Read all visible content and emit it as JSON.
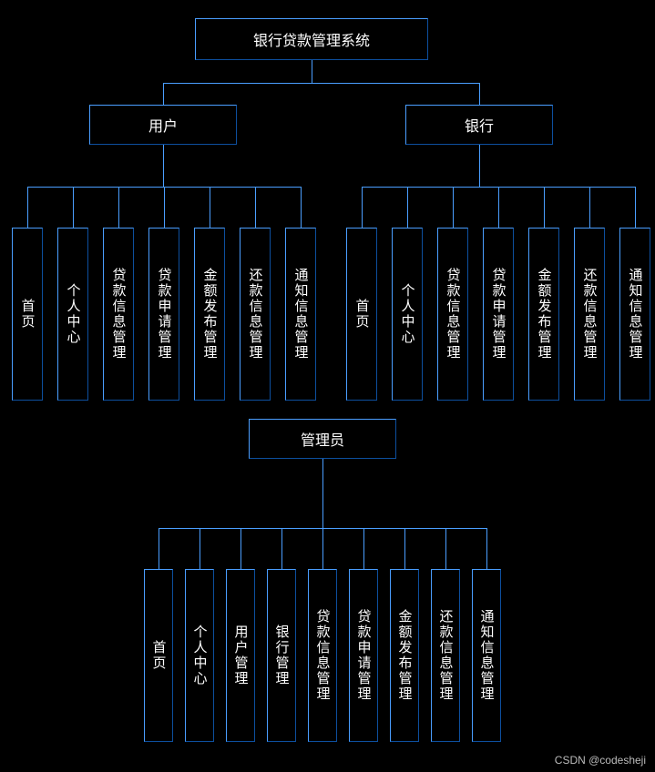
{
  "title": "银行贷款管理系统",
  "roles": {
    "user": {
      "label": "用户",
      "modules": [
        "首页",
        "个人中心",
        "贷款信息管理",
        "贷款申请管理",
        "金额发布管理",
        "还款信息管理",
        "通知信息管理"
      ]
    },
    "bank": {
      "label": "银行",
      "modules": [
        "首页",
        "个人中心",
        "贷款信息管理",
        "贷款申请管理",
        "金额发布管理",
        "还款信息管理",
        "通知信息管理"
      ]
    },
    "admin": {
      "label": "管理员",
      "modules": [
        "首页",
        "个人中心",
        "用户管理",
        "银行管理",
        "贷款信息管理",
        "贷款申请管理",
        "金额发布管理",
        "还款信息管理",
        "通知信息管理"
      ]
    }
  },
  "watermark": "CSDN @codesheji"
}
